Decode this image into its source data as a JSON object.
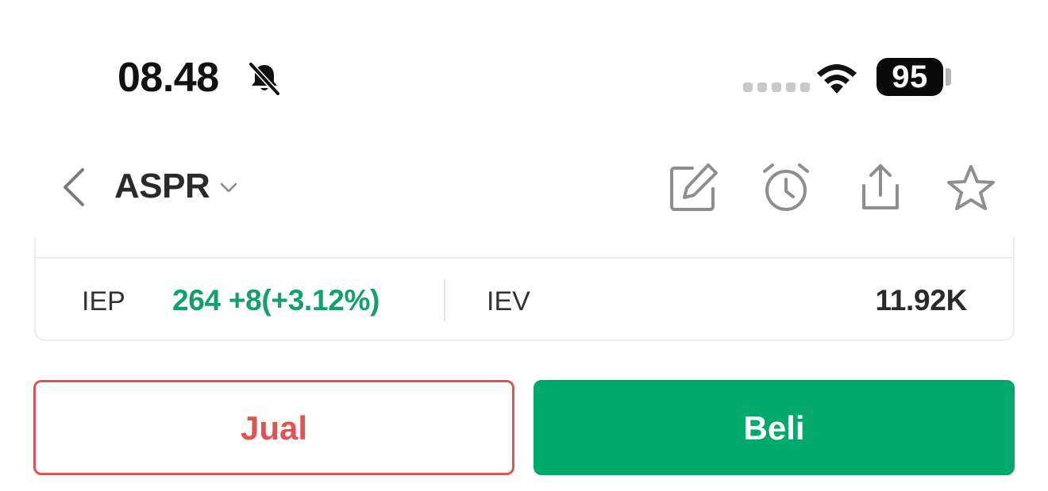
{
  "status_bar": {
    "time": "08.48",
    "battery": "95",
    "icons": [
      "bell-slash-icon",
      "signal-dots-icon",
      "wifi-icon",
      "battery-icon"
    ]
  },
  "header": {
    "ticker": "ASPR",
    "icons": [
      "back-chevron-icon",
      "chevron-down-icon",
      "edit-icon",
      "alarm-clock-icon",
      "share-icon",
      "star-icon"
    ]
  },
  "quote": {
    "iep_label": "IEP",
    "iep_value": "264 +8(+3.12%)",
    "iev_label": "IEV",
    "iev_value": "11.92K"
  },
  "actions": {
    "sell_label": "Jual",
    "buy_label": "Beli"
  },
  "colors": {
    "positive": "#13a06a",
    "sell": "#df5452",
    "buy": "#03a86b",
    "icon_gray": "#8e8e8e"
  }
}
